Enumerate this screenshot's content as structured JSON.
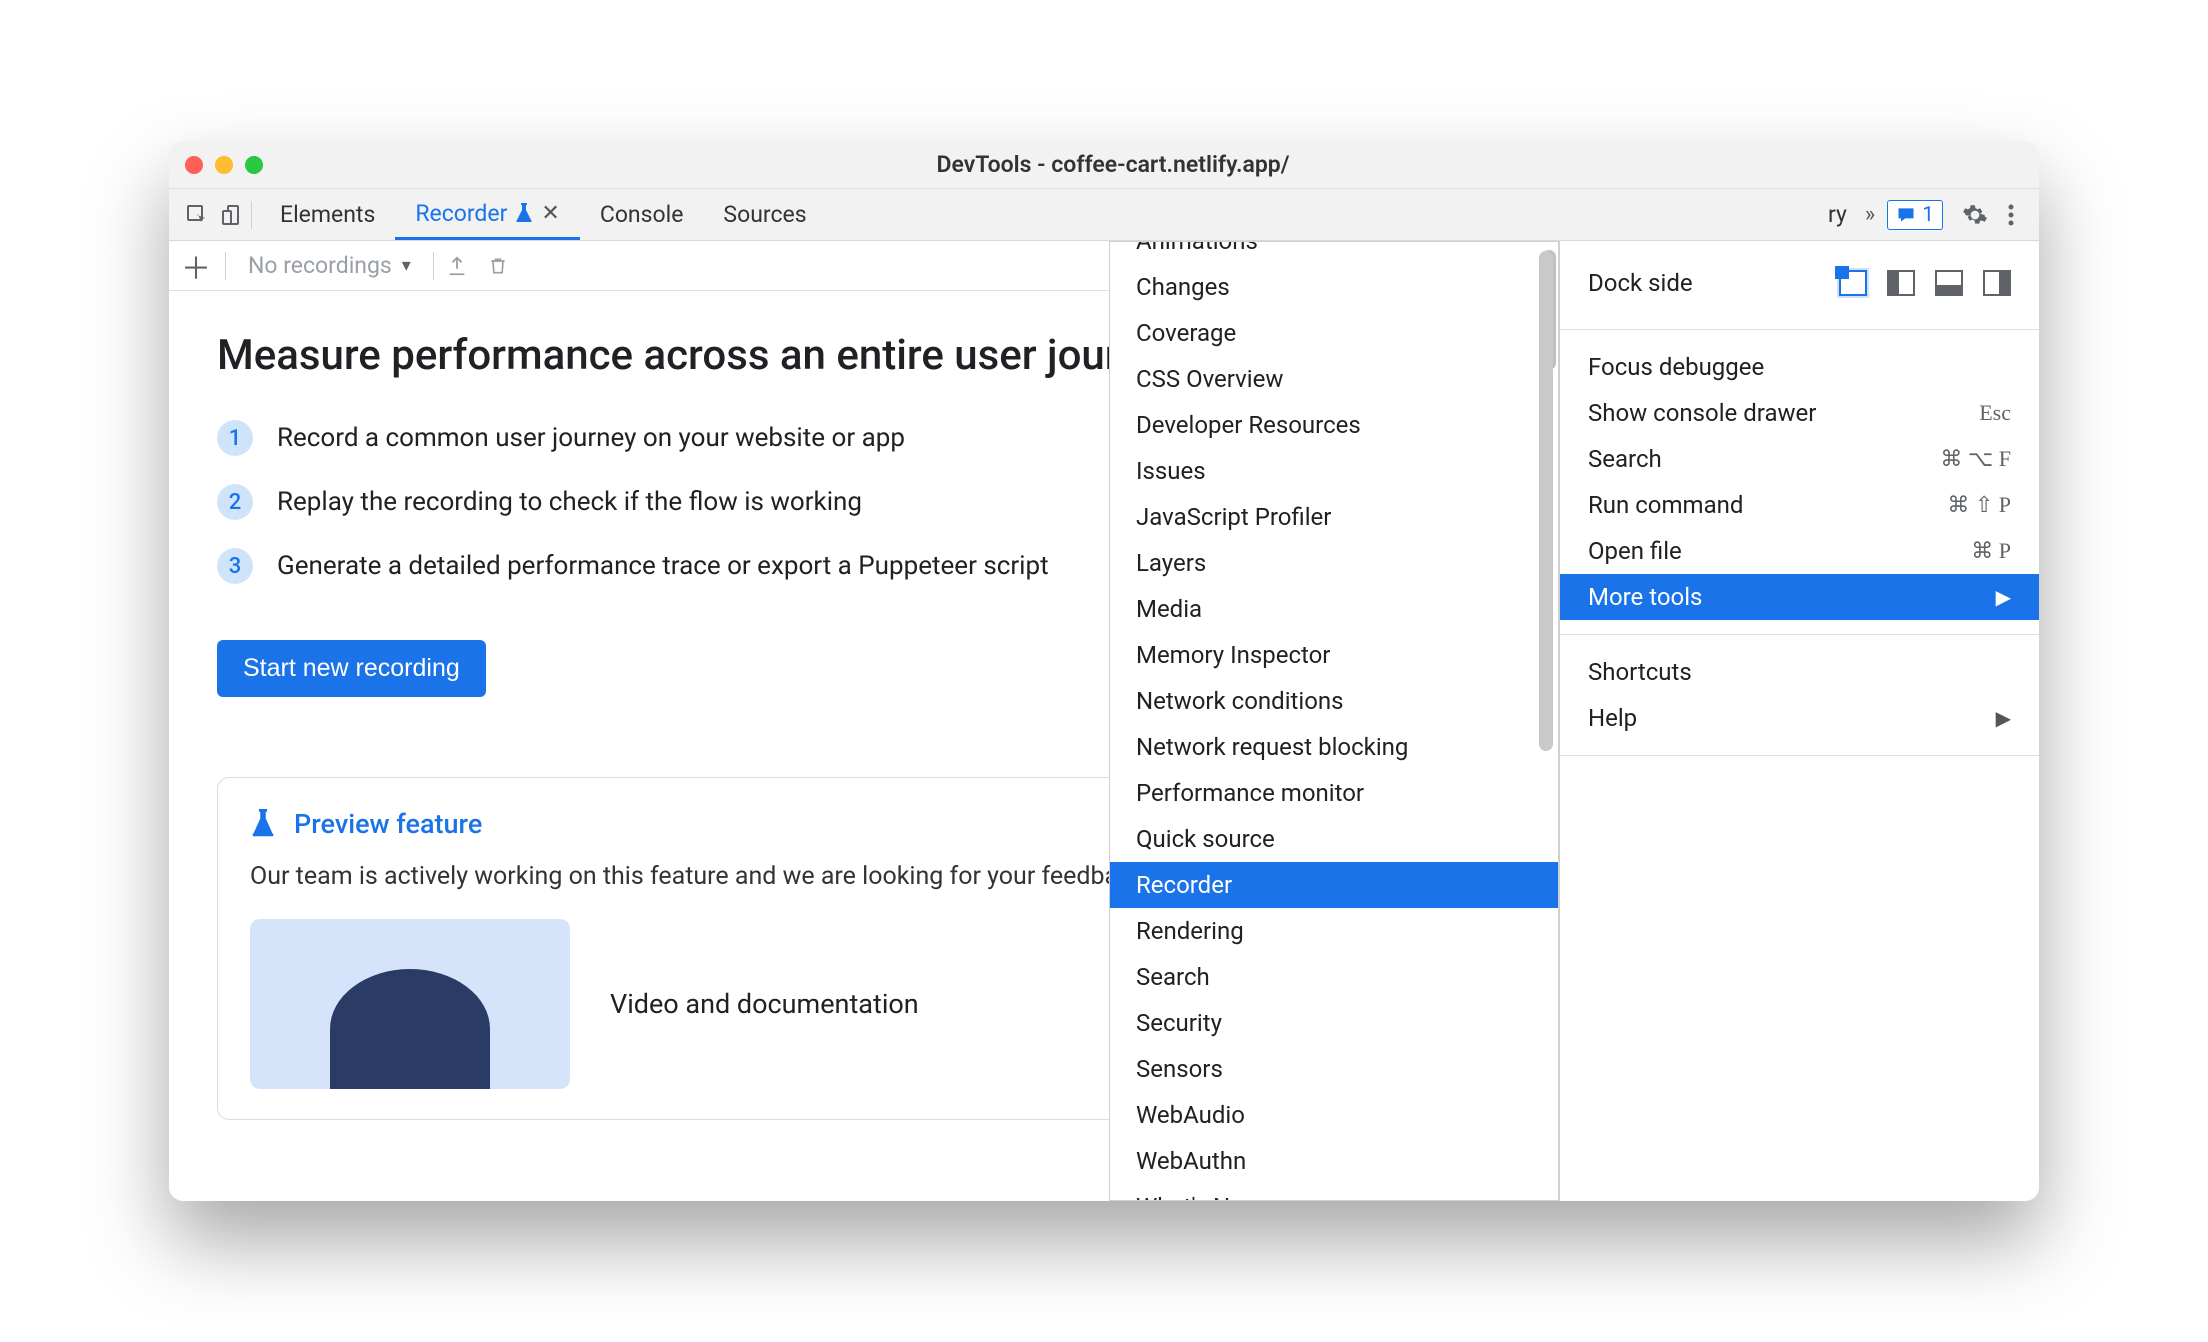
{
  "window": {
    "title": "DevTools - coffee-cart.netlify.app/"
  },
  "topbar": {
    "tabs": [
      {
        "label": "Elements",
        "active": false
      },
      {
        "label": "Recorder",
        "active": true,
        "closable": true
      },
      {
        "label": "Console",
        "active": false
      },
      {
        "label": "Sources",
        "active": false
      }
    ],
    "overflow_hint": "ry",
    "message_count": "1"
  },
  "toolbar": {
    "recording_selector": "No recordings"
  },
  "panel": {
    "heading": "Measure performance across an entire user journey",
    "steps": [
      "Record a common user journey on your website or app",
      "Replay the recording to check if the flow is working",
      "Generate a detailed performance trace or export a Puppeteer script"
    ],
    "start_button": "Start new recording",
    "preview": {
      "title": "Preview feature",
      "body": "Our team is actively working on this feature and we are looking for your feedback.",
      "media_caption": "Video and documentation"
    }
  },
  "main_menu": {
    "dock_label": "Dock side",
    "items": [
      {
        "label": "Focus debuggee",
        "shortcut": ""
      },
      {
        "label": "Show console drawer",
        "shortcut": "Esc"
      },
      {
        "label": "Search",
        "shortcut": "⌘ ⌥ F"
      },
      {
        "label": "Run command",
        "shortcut": "⌘ ⇧ P"
      },
      {
        "label": "Open file",
        "shortcut": "⌘ P"
      },
      {
        "label": "More tools",
        "shortcut": "",
        "submenu": true,
        "highlight": true
      }
    ],
    "items2": [
      {
        "label": "Shortcuts",
        "shortcut": ""
      },
      {
        "label": "Help",
        "shortcut": "",
        "submenu": true
      }
    ]
  },
  "submenu": {
    "items": [
      "Animations",
      "Changes",
      "Coverage",
      "CSS Overview",
      "Developer Resources",
      "Issues",
      "JavaScript Profiler",
      "Layers",
      "Media",
      "Memory Inspector",
      "Network conditions",
      "Network request blocking",
      "Performance monitor",
      "Quick source",
      "Recorder",
      "Rendering",
      "Search",
      "Security",
      "Sensors",
      "WebAudio",
      "WebAuthn",
      "What's New"
    ],
    "highlight": "Recorder"
  }
}
